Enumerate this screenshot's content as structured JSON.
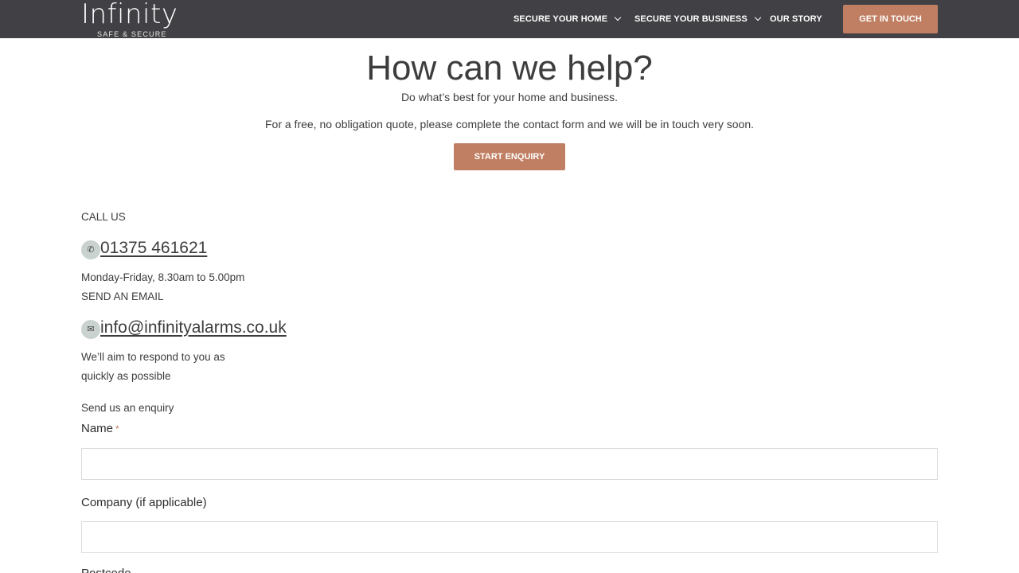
{
  "header": {
    "logo_word": "Infinity",
    "logo_tagline": "SAFE & SECURE",
    "nav": {
      "home": "SECURE YOUR HOME",
      "business": "SECURE YOUR BUSINESS",
      "story": "OUR STORY"
    },
    "cta": "GET IN TOUCH"
  },
  "hero": {
    "title": "How can we help?",
    "subtitle": "Do what’s best for your home and business.",
    "description": "For a free, no obligation quote, please complete the contact form and we will be in touch very soon.",
    "button": "START ENQUIRY"
  },
  "contact": {
    "call_label": "CALL US",
    "phone": "01375 461621",
    "hours": "Monday-Friday, 8.30am to 5.00pm",
    "email_label": "SEND AN EMAIL",
    "email": "info@infinityalarms.co.uk",
    "respond_line1": "We’ll aim to respond to you as",
    "respond_line2": "quickly as possible"
  },
  "form": {
    "heading": "Send us an enquiry",
    "name_label": "Name",
    "required_mark": "*",
    "name_value": "",
    "company_label": "Company (if applicable)",
    "company_value": "",
    "postcode_label": "Postcode"
  },
  "colors": {
    "header_bg": "#414145",
    "accent": "#c07f63",
    "icon_bg": "#c9d2cf"
  },
  "icons": {
    "phone": "phone-icon",
    "email": "envelope-icon",
    "chevron": "chevron-down-icon"
  }
}
